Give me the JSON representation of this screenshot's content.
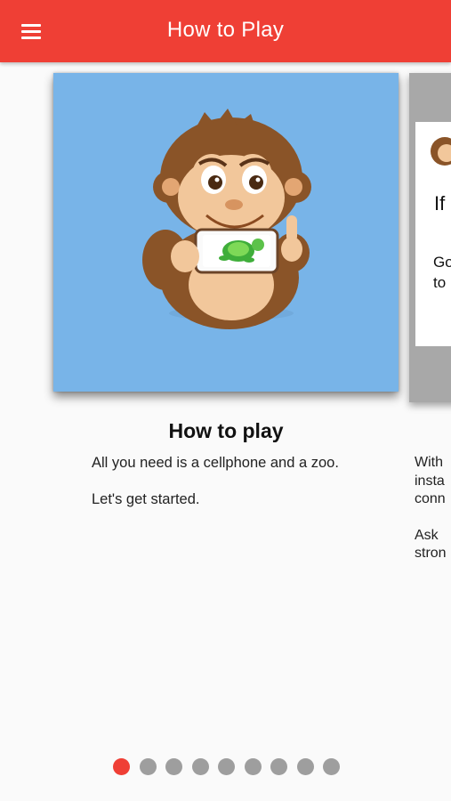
{
  "appbar": {
    "title": "How to Play",
    "menu_icon": "hamburger-menu-icon",
    "color": "#ef3f35"
  },
  "slides": [
    {
      "title": "How to play",
      "image": "monkey-holding-phone-with-turtle",
      "image_bg": "#78b4e8",
      "paragraphs": [
        "All you need is a cellphone and a zoo.",
        "Let's get started."
      ]
    },
    {
      "card_title": "If",
      "card_text": [
        "Go",
        "to"
      ],
      "paragraphs": [
        [
          "With",
          "insta",
          "conn"
        ],
        [
          "Ask",
          "stron"
        ]
      ]
    }
  ],
  "pager": {
    "count": 9,
    "active_index": 0,
    "active_color": "#ef3f35",
    "inactive_color": "#9e9e9e"
  }
}
